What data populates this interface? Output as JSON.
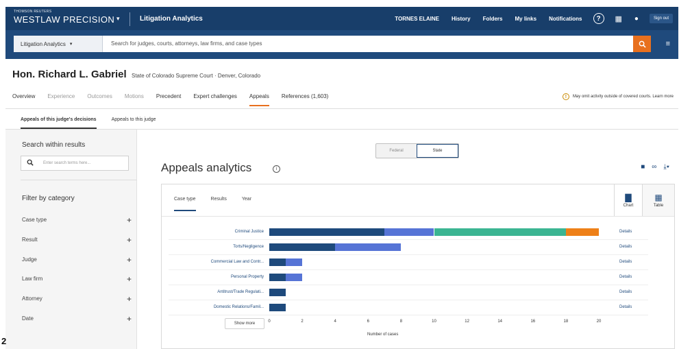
{
  "header": {
    "logo_small": "THOMSON REUTERS",
    "logo_big": "WESTLAW PRECISION",
    "product": "Litigation Analytics",
    "nav": [
      "TORNES ELAINE",
      "History",
      "Folders",
      "My links",
      "Notifications"
    ],
    "signout": "Sign out"
  },
  "search": {
    "scope": "Litigation Analytics",
    "placeholder": "Search for judges, courts, attorneys, law firms, and case types"
  },
  "judge": {
    "name": "Hon. Richard L. Gabriel",
    "meta": "State of Colorado Supreme Court  ·  Denver, Colorado"
  },
  "tabs": [
    {
      "label": "Overview",
      "state": "dark"
    },
    {
      "label": "Experience",
      "state": "dim"
    },
    {
      "label": "Outcomes",
      "state": "dim"
    },
    {
      "label": "Motions",
      "state": "dim"
    },
    {
      "label": "Precedent",
      "state": "dark"
    },
    {
      "label": "Expert challenges",
      "state": "dark"
    },
    {
      "label": "Appeals",
      "state": "active"
    },
    {
      "label": "References (1,603)",
      "state": "dark"
    }
  ],
  "notice": "May omit activity outside of covered courts. Learn more",
  "subtabs": [
    "Appeals of this judge's decisions",
    "Appeals to this judge"
  ],
  "left": {
    "search_title": "Search within results",
    "search_placeholder": "Enter search terms here...",
    "filter_title": "Filter by category",
    "categories": [
      "Case type",
      "Result",
      "Judge",
      "Law firm",
      "Attorney",
      "Date"
    ]
  },
  "toggle": {
    "federal": "Federal",
    "state": "State"
  },
  "main": {
    "title": "Appeals analytics",
    "card_tabs": [
      "Case type",
      "Results",
      "Year"
    ],
    "view_chart": "Chart",
    "view_table": "Table",
    "show_more": "Show more",
    "details": "Details"
  },
  "colors": {
    "navy": "#1e4a7c",
    "blue": "#5674d6",
    "teal": "#3bb592",
    "orange": "#ee8018"
  },
  "chart_data": {
    "type": "bar",
    "orientation": "horizontal",
    "stacked": true,
    "categories": [
      "Criminal Justice",
      "Torts/Negligence",
      "Commercial Law and Contr...",
      "Personal Property",
      "Antitrust/Trade Regulati...",
      "Domestic Relations/Famil..."
    ],
    "segments": [
      [
        7,
        3,
        8,
        2
      ],
      [
        4,
        4,
        0,
        0
      ],
      [
        1,
        1,
        0,
        0
      ],
      [
        1,
        1,
        0,
        0
      ],
      [
        1,
        0,
        0,
        0
      ],
      [
        1,
        0,
        0,
        0
      ]
    ],
    "segment_colors": [
      "#1e4a7c",
      "#5674d6",
      "#3bb592",
      "#ee8018"
    ],
    "xticks": [
      0,
      2,
      4,
      6,
      8,
      10,
      12,
      14,
      16,
      18,
      20
    ],
    "xlim": [
      0,
      20
    ],
    "xlabel": "Number of cases"
  },
  "footnote": "2"
}
